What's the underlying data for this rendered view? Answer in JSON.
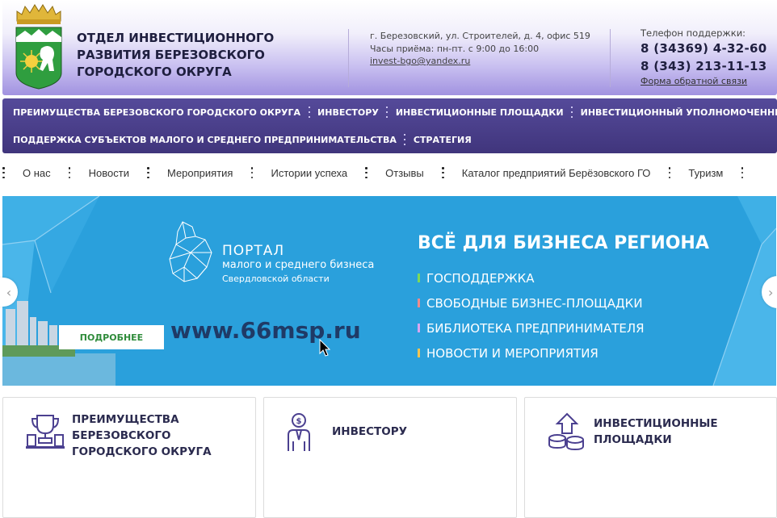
{
  "header": {
    "org_title": "ОТДЕЛ ИНВЕСТИЦИОННОГО РАЗВИТИЯ БЕРЕЗОВСКОГО ГОРОДСКОГО ОКРУГА",
    "address": "г. Березовский, ул. Строителей, д. 4, офис 519",
    "hours": "Часы приёма: пн-пт. с 9:00 до 16:00",
    "email": "invest-bgo@yandex.ru",
    "phone_label": "Телефон поддержки:",
    "phone1": "8 (34369) 4-32-60",
    "phone2": "8 (343) 213-11-13",
    "feedback_link": "Форма обратной связи"
  },
  "main_nav": {
    "items": [
      "ПРЕИМУЩЕСТВА БЕРЕЗОВСКОГО ГОРОДСКОГО ОКРУГА",
      "ИНВЕСТОРУ",
      "ИНВЕСТИЦИОННЫЕ ПЛОЩАДКИ",
      "ИНВЕСТИЦИОННЫЙ УПОЛНОМОЧЕННЫЙ",
      "ПОДДЕРЖКА СУБЪЕКТОВ МАЛОГО И СРЕДНЕГО ПРЕДПРИНИМАТЕЛЬСТВА",
      "СТРАТЕГИЯ"
    ]
  },
  "sub_nav": {
    "items": [
      "О нас",
      "Новости",
      "Мероприятия",
      "Истории успеха",
      "Отзывы",
      "Каталог предприятий Берёзовского ГО",
      "Туризм"
    ]
  },
  "banner": {
    "portal_title": "ПОРТАЛ",
    "portal_subtitle": "малого и среднего бизнеса",
    "portal_region": "Свердловской области",
    "headline": "ВСЁ ДЛЯ БИЗНЕСА РЕГИОНА",
    "bullets": [
      {
        "text": "ГОСПОДДЕРЖКА",
        "color": "#7ed957"
      },
      {
        "text": "СВОБОДНЫЕ БИЗНЕС-ПЛОЩАДКИ",
        "color": "#f08a8a"
      },
      {
        "text": "БИБЛИОТЕКА ПРЕДПРИНИМАТЕЛЯ",
        "color": "#d7a6f0"
      },
      {
        "text": "НОВОСТИ И МЕРОПРИЯТИЯ",
        "color": "#f5c451"
      }
    ],
    "more_button": "ПОДРОБНЕЕ",
    "url": "www.66msp.ru",
    "prev_arrow": "‹",
    "next_arrow": "›"
  },
  "cards": [
    {
      "title": "ПРЕИМУЩЕСТВА БЕРЕЗОВСКОГО ГОРОДСКОГО ОКРУГА",
      "icon": "trophy-icon"
    },
    {
      "title": "ИНВЕСТОРУ",
      "icon": "investor-icon"
    },
    {
      "title": "ИНВЕСТИЦИОННЫЕ ПЛОЩАДКИ",
      "icon": "coins-growth-icon"
    }
  ],
  "colors": {
    "nav_bg": "#4b4090",
    "header_gradient_end": "#a192e0",
    "banner_bg": "#2aa0dc",
    "url_text": "#1f3a66",
    "more_button_text": "#2e8b3a"
  }
}
